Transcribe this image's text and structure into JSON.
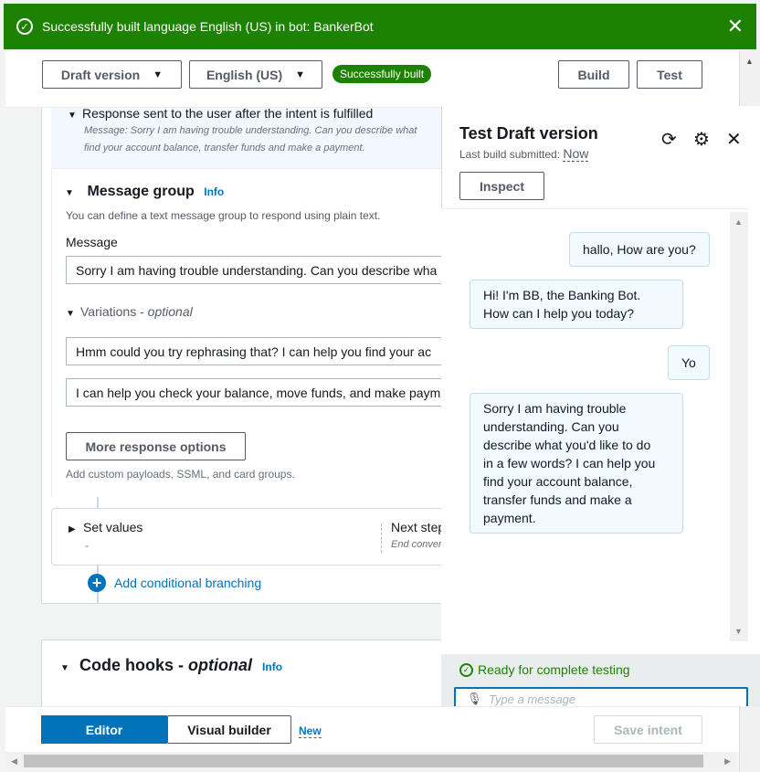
{
  "flash": {
    "message": "Successfully built language English (US) in bot: BankerBot"
  },
  "header": {
    "version_select": "Draft version",
    "language_select": "English (US)",
    "status_badge": "Successfully built",
    "build_label": "Build",
    "test_label": "Test"
  },
  "response": {
    "title": "Response sent to the user after the intent is fulfilled",
    "preview_line1": "Message: Sorry I am having trouble understanding. Can you describe what",
    "preview_line2": "find your account balance, transfer funds and make a payment."
  },
  "message_group": {
    "title": "Message group",
    "info": "Info",
    "description": "You can define a text message group to respond using plain text.",
    "message_label": "Message",
    "message_value": "Sorry I am having trouble understanding. Can you describe wha",
    "variations_label": "Variations - ",
    "variations_optional": "optional",
    "variation1": "Hmm could you try rephrasing that? I can help you find your ac",
    "variation2": "I can help you check your balance, move funds, and make paym",
    "more_options_label": "More response options",
    "custom_hint": "Add custom payloads, SSML, and card groups."
  },
  "set_values": {
    "title": "Set values",
    "value": "-",
    "next_step_title": "Next step",
    "next_step_value": "End conver"
  },
  "branching": {
    "label": "Add conditional branching"
  },
  "code_hooks": {
    "title": "Code hooks - ",
    "optional": "optional",
    "info": "Info"
  },
  "test_panel": {
    "title": "Test Draft version",
    "last_build_label": "Last build submitted: ",
    "last_build_value": "Now",
    "inspect_label": "Inspect",
    "messages": [
      {
        "from": "user",
        "text": "hallo, How are you?"
      },
      {
        "from": "bot",
        "lines": [
          "Hi! I'm BB, the Banking Bot.",
          "How can I help you today?"
        ]
      },
      {
        "from": "user",
        "text": "Yo"
      },
      {
        "from": "bot",
        "lines": [
          "Sorry I am having trouble",
          "understanding. Can you",
          "describe what you'd like to do",
          "in a few words? I can help you",
          "find your account balance,",
          "transfer funds and make a",
          "payment."
        ]
      }
    ],
    "ready_label": "Ready for complete testing",
    "input_placeholder": "Type a message"
  },
  "footer": {
    "editor_label": "Editor",
    "visual_builder_label": "Visual builder",
    "new_label": "New",
    "save_label": "Save intent"
  },
  "colors": {
    "success": "#1d8102",
    "primary": "#0073bb",
    "border": "#aab7b8"
  }
}
